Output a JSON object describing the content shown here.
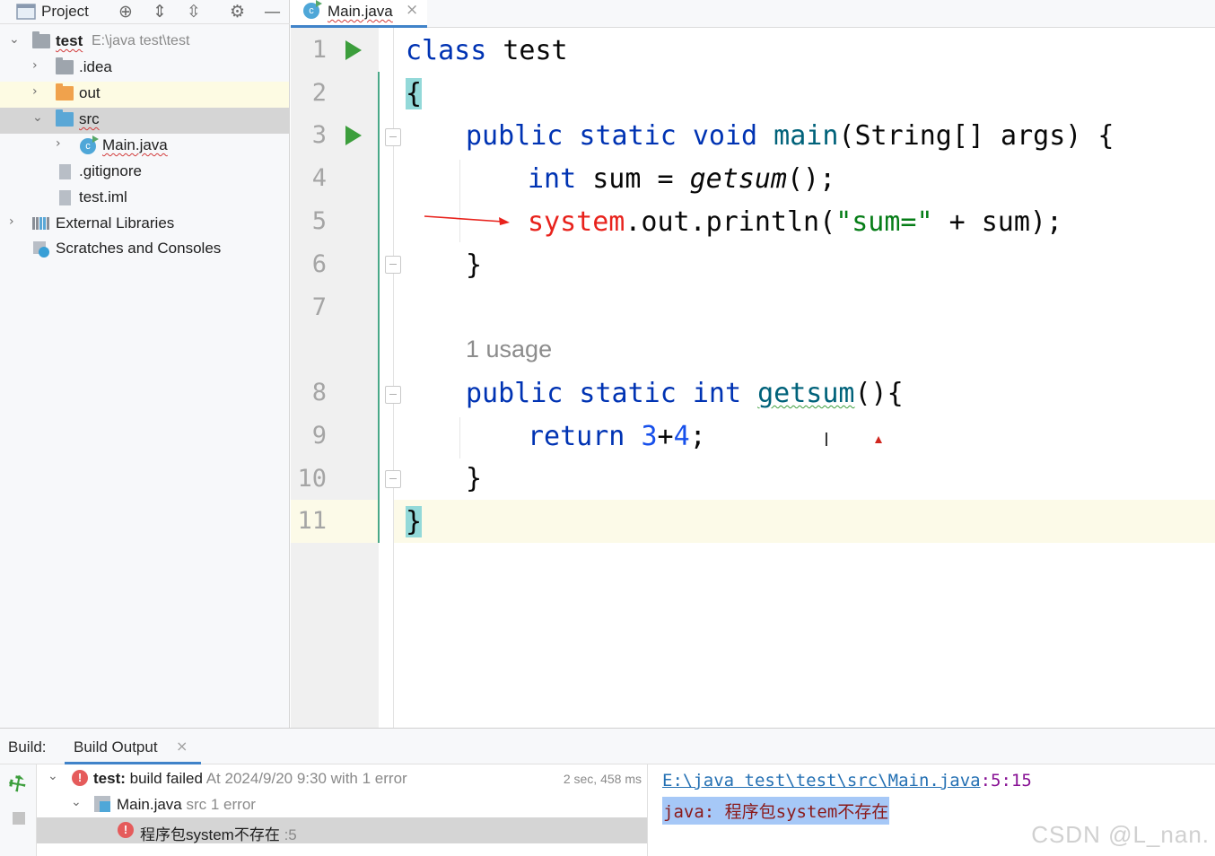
{
  "project_panel": {
    "title": "Project",
    "toolbar_icons": [
      "target-icon",
      "expand-all-icon",
      "collapse-all-icon",
      "gear-icon",
      "minimize-icon"
    ],
    "tree": [
      {
        "label": "test",
        "path": "E:\\java test\\test",
        "icon": "project-folder-icon"
      },
      {
        "label": ".idea",
        "icon": "folder-icon"
      },
      {
        "label": "out",
        "icon": "folder-orange-icon"
      },
      {
        "label": "src",
        "icon": "folder-blue-icon"
      },
      {
        "label": "Main.java",
        "icon": "java-class-icon"
      },
      {
        "label": ".gitignore",
        "icon": "ignore-file-icon"
      },
      {
        "label": "test.iml",
        "icon": "iml-file-icon"
      },
      {
        "label": "External Libraries",
        "icon": "libraries-icon"
      },
      {
        "label": "Scratches and Consoles",
        "icon": "scratches-icon"
      }
    ]
  },
  "editor": {
    "tab_label": "Main.java",
    "line_numbers": [
      "1",
      "2",
      "3",
      "4",
      "5",
      "6",
      "7",
      "8",
      "9",
      "10",
      "11"
    ],
    "usage_hint": "1 usage",
    "code": {
      "l1_kw": "class",
      "l1_rest": " test",
      "l2": "{",
      "l3_kw": "public static void",
      "l3_fn": "main",
      "l3_rest": "(String[] args) {",
      "l4_kw": "int",
      "l4_mid": " sum = ",
      "l4_call": "getsum",
      "l4_end": "();",
      "l5_err": "system",
      "l5_mid": ".out.println(",
      "l5_str": "\"sum=\"",
      "l5_end": " + sum);",
      "l6": "}",
      "l8_kw": "public static int",
      "l8_fn": "getsum",
      "l8_end": "(){",
      "l9_kw": "return",
      "l9_n1": "3",
      "l9_op": "+",
      "l9_n2": "4",
      "l9_end": ";",
      "l10": "}",
      "l11": "}"
    }
  },
  "build": {
    "title": "Build:",
    "tab_label": "Build Output",
    "rows": {
      "r1_name": "test:",
      "r1_msg": " build failed",
      "r1_time": " At 2024/9/20 9:30 with 1 error",
      "r1_duration": "2 sec, 458 ms",
      "r2_file": "Main.java",
      "r2_sub": " src 1 error",
      "r3_msg": "程序包system不存在",
      "r3_line": " :5"
    },
    "output": {
      "link": "E:\\java test\\test\\src\\Main.java",
      "location": ":5:15",
      "message": "java: 程序包system不存在"
    }
  },
  "watermark": "CSDN @L_nan.",
  "colors": {
    "keyword": "#0033b3",
    "method": "#00627a",
    "string": "#067d17",
    "number": "#1750eb",
    "error": "#e8221c",
    "accent": "#4083c9"
  }
}
